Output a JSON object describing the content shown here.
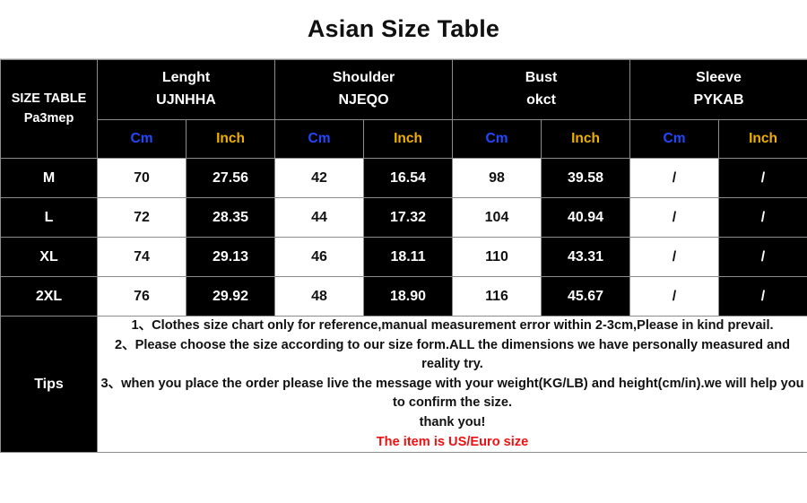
{
  "title": "Asian Size Table",
  "table": {
    "corner": {
      "line1": "SIZE TABLE",
      "line2": "Pa3mep"
    },
    "groups": [
      {
        "name": "Lenght",
        "sub": "UJNHHA"
      },
      {
        "name": "Shoulder",
        "sub": "NJEQO"
      },
      {
        "name": "Bust",
        "sub": "okct"
      },
      {
        "name": "Sleeve",
        "sub": "PYKAB"
      }
    ],
    "units": [
      {
        "cm": "Cm",
        "inch": "Inch"
      },
      {
        "cm": "Cm",
        "inch": "Inch"
      },
      {
        "cm": "Cm",
        "inch": "Inch"
      },
      {
        "cm": "Cm",
        "inch": "Inch"
      }
    ],
    "rows": [
      {
        "size": "M",
        "length_cm": "70",
        "length_inch": "27.56",
        "shoulder_cm": "42",
        "shoulder_inch": "16.54",
        "bust_cm": "98",
        "bust_inch": "39.58",
        "sleeve_cm": "/",
        "sleeve_inch": "/"
      },
      {
        "size": "L",
        "length_cm": "72",
        "length_inch": "28.35",
        "shoulder_cm": "44",
        "shoulder_inch": "17.32",
        "bust_cm": "104",
        "bust_inch": "40.94",
        "sleeve_cm": "/",
        "sleeve_inch": "/"
      },
      {
        "size": "XL",
        "length_cm": "74",
        "length_inch": "29.13",
        "shoulder_cm": "46",
        "shoulder_inch": "18.11",
        "bust_cm": "110",
        "bust_inch": "43.31",
        "sleeve_cm": "/",
        "sleeve_inch": "/"
      },
      {
        "size": "2XL",
        "length_cm": "76",
        "length_inch": "29.92",
        "shoulder_cm": "48",
        "shoulder_inch": "18.90",
        "bust_cm": "116",
        "bust_inch": "45.67",
        "sleeve_cm": "/",
        "sleeve_inch": "/"
      }
    ],
    "tips": {
      "label": "Tips",
      "lines": [
        "1、Clothes size chart only for reference,manual measurement error within 2-3cm,Please in kind prevail.",
        "2、Please choose the size according to our size form.ALL the dimensions we have personally measured and reality try.",
        "3、when you place the order please live the message with your weight(KG/LB) and height(cm/in).we will help you to confirm the size.",
        "thank you!"
      ],
      "highlight": "The item is US/Euro size"
    }
  },
  "colors": {
    "cm_blue": "#2248ff",
    "inch_gold": "#f0b000",
    "highlight_red": "#ee1111",
    "table_black": "#000000",
    "cell_white": "#ffffff",
    "border_gray": "#8c8c8c"
  }
}
